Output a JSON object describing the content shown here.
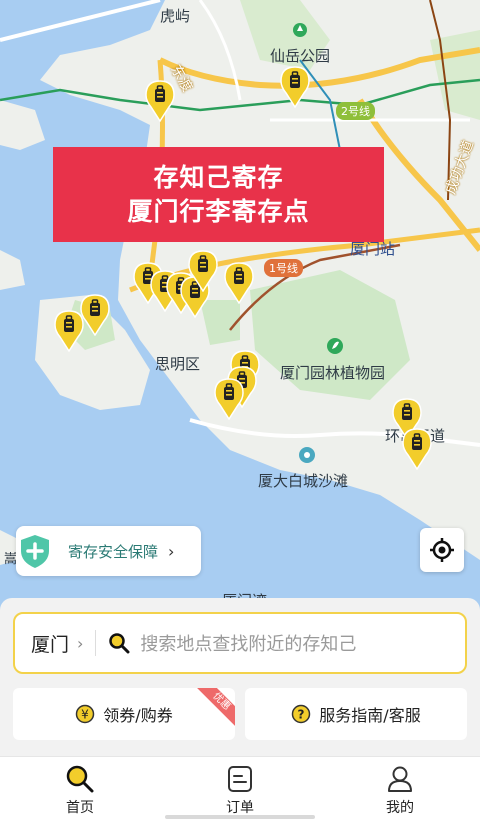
{
  "map": {
    "labels": {
      "huyu": "虎屿",
      "xianyue_park": "仙岳公园",
      "dongdu": "东渡",
      "siming": "思明区",
      "xiamen_station": "厦门站",
      "botanical": "厦门园林植物园",
      "baicheng_beach": "厦大白城沙滩",
      "chenggong_road": "成功大道",
      "huandao_road": "环岛干道",
      "xiamen_bay": "厦门湾",
      "left_edge": "嵩"
    },
    "metro": {
      "line1": "1号线",
      "line2": "2号线"
    },
    "colors": {
      "water": "#a8cdf2",
      "land": "#eef0ec",
      "park": "#cfe8c7",
      "road": "#f7c64a",
      "pin": "#f2cd2b",
      "banner": "#e8324a"
    }
  },
  "banner": {
    "line1": "存知己寄存",
    "line2": "厦门行李寄存点"
  },
  "safety": {
    "label": "寄存安全保障",
    "icon": "shield-plus-icon"
  },
  "search": {
    "city": "厦门",
    "placeholder": "搜索地点查找附近的存知己"
  },
  "actions": {
    "coupon_label": "领券/购券",
    "coupon_badge": "优惠",
    "guide_label": "服务指南/客服"
  },
  "tabs": [
    {
      "label": "首页",
      "icon": "search-icon"
    },
    {
      "label": "订单",
      "icon": "order-icon"
    },
    {
      "label": "我的",
      "icon": "user-icon"
    }
  ]
}
